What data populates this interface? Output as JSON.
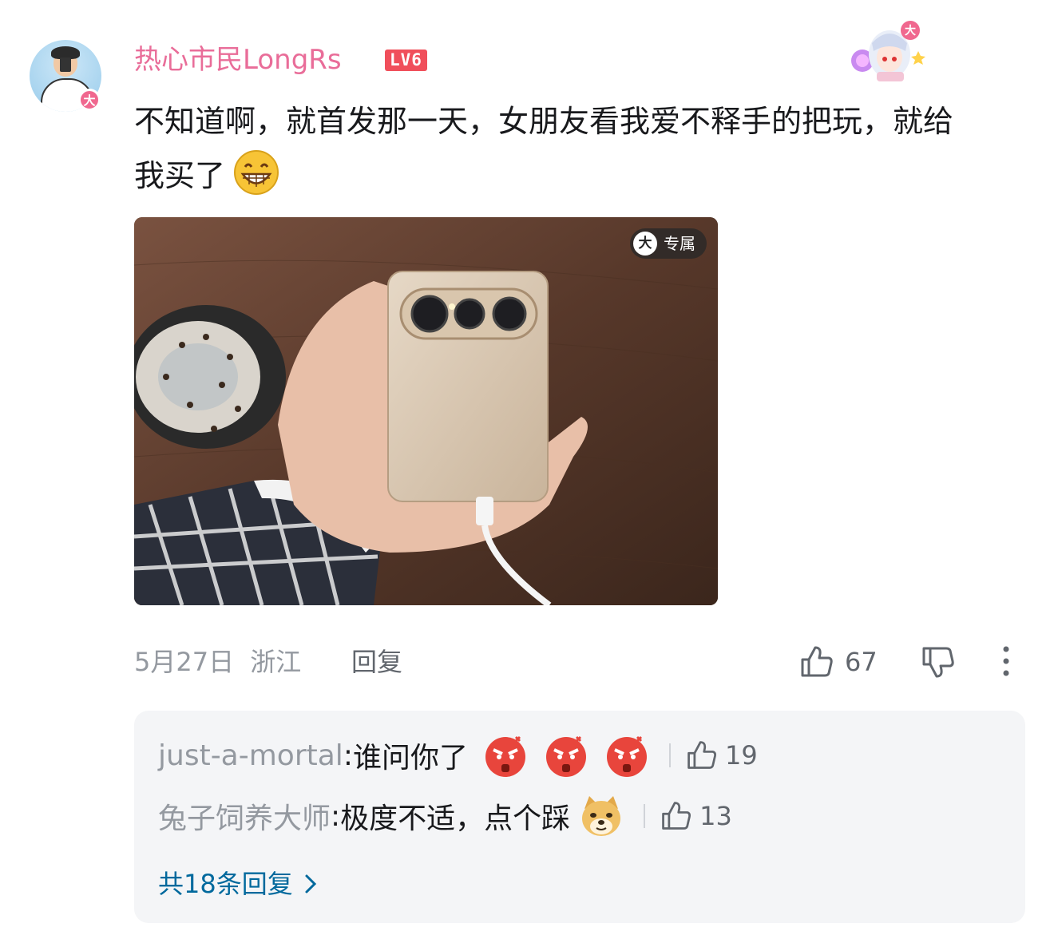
{
  "comment": {
    "username": "热心市民LongRs",
    "level": "LV6",
    "vip_badge": "大",
    "text": "不知道啊，就首发那一天，女朋友看我爱不释手的把玩，就给我买了",
    "emoji": "grinning-face-emoji",
    "image_tag": {
      "icon": "大",
      "label": "专属"
    },
    "date": "5月27日",
    "location": "浙江",
    "reply_label": "回复",
    "like_count": "67"
  },
  "replies": [
    {
      "user": "just-a-mortal",
      "text": "谁问你了",
      "emojis": [
        "angry-face-emoji",
        "angry-face-emoji",
        "angry-face-emoji"
      ],
      "like_count": "19"
    },
    {
      "user": "兔子饲养大师",
      "text": "极度不适，点个踩",
      "emojis": [
        "doge-emoji"
      ],
      "like_count": "13"
    }
  ],
  "more_replies_label": "共18条回复",
  "colors": {
    "username": "#e96d99",
    "level_badge": "#f04f5b",
    "link": "#00699d",
    "muted": "#9499a0",
    "reply_bg": "#f4f5f7"
  }
}
